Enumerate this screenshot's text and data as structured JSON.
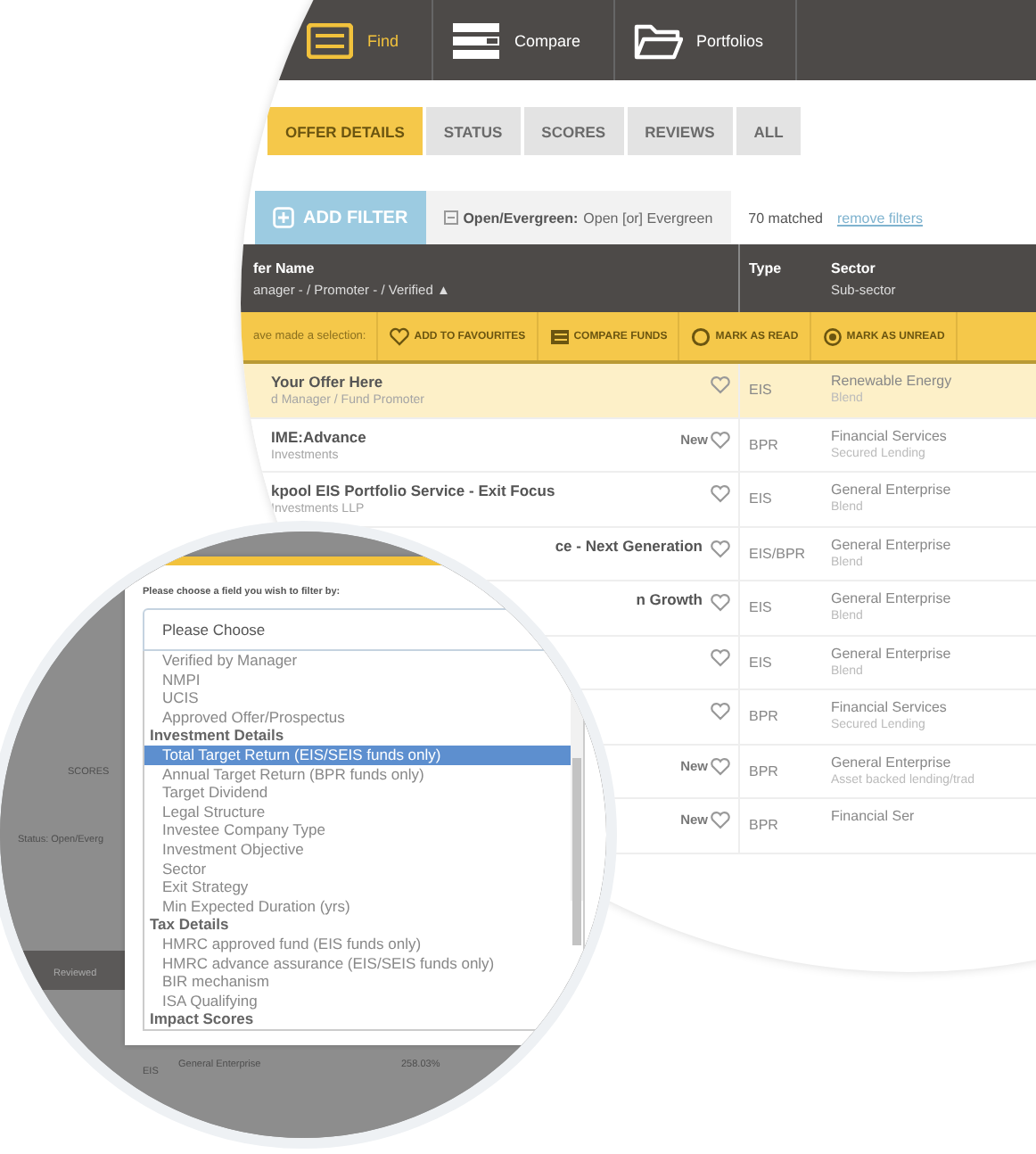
{
  "nav": {
    "items": [
      {
        "label": "Find",
        "selected": true
      },
      {
        "label": "Compare",
        "selected": false
      },
      {
        "label": "Portfolios",
        "selected": false
      }
    ]
  },
  "tabs": [
    {
      "label": "OFFER DETAILS",
      "selected": true
    },
    {
      "label": "STATUS",
      "selected": false
    },
    {
      "label": "SCORES",
      "selected": false
    },
    {
      "label": "REVIEWS",
      "selected": false
    },
    {
      "label": "ALL",
      "selected": false
    }
  ],
  "filter_bar": {
    "add_button": "ADD FILTER",
    "filter_name": "Open/Evergreen:",
    "filter_value": "Open [or] Evergreen",
    "matched": "70 matched",
    "remove_link": "remove filters"
  },
  "table": {
    "columns": [
      {
        "title": "fer Name",
        "subtitle": "anager - / Promoter - / Verified ▲"
      },
      {
        "title": "Type"
      },
      {
        "title": "Sector",
        "subtitle": "Sub-sector"
      }
    ],
    "selection_bar": {
      "label": "ave made a selection:",
      "actions": [
        {
          "label": "ADD TO FAVOURITES"
        },
        {
          "label": "COMPARE FUNDS"
        },
        {
          "label": "MARK AS READ"
        },
        {
          "label": "MARK AS UNREAD"
        }
      ]
    },
    "rows": [
      {
        "name": "Your Offer Here",
        "manager": "d Manager / Fund Promoter",
        "selected": true,
        "type": "EIS",
        "sector": "Renewable Energy",
        "sub_sector": "Blend"
      },
      {
        "name": "IME:Advance",
        "manager": "Investments",
        "new_label": "New",
        "selected": false,
        "type": "BPR",
        "sector": "Financial Services",
        "sub_sector": "Secured Lending"
      },
      {
        "name": "kpool EIS Portfolio Service - Exit Focus",
        "manager": "Investments LLP",
        "selected": false,
        "type": "EIS",
        "sector": "General Enterprise",
        "sub_sector": "Blend"
      },
      {
        "name": "ce - Next Generation",
        "selected": false,
        "cut": true,
        "type": "EIS/BPR",
        "sector": "General Enterprise",
        "sub_sector": "Blend"
      },
      {
        "name": "n Growth",
        "selected": false,
        "cut": true,
        "type": "EIS",
        "sector": "General Enterprise",
        "sub_sector": "Blend"
      },
      {
        "selected": false,
        "type": "EIS",
        "sector": "General Enterprise",
        "sub_sector": "Blend"
      },
      {
        "selected": false,
        "type": "BPR",
        "sector": "Financial Services",
        "sub_sector": "Secured Lending"
      },
      {
        "new_label": "New",
        "selected": false,
        "type": "BPR",
        "sector": "General Enterprise",
        "sub_sector": "Asset backed lending/trad"
      },
      {
        "new_label": "New",
        "selected": false,
        "type": "BPR",
        "sector": "Financial Ser"
      }
    ]
  },
  "background_page": {
    "tab": "SCORES",
    "filter": "Status: Open/Everg",
    "column": "Reviewed",
    "type": "EIS",
    "sector": "General Enterprise",
    "value": "258.03%"
  },
  "filter_dialog": {
    "prompt": "Please choose a field you wish to filter by:",
    "select": {
      "value": "Please Choose"
    },
    "groups": [
      {
        "options": [
          {
            "label": "Verified by Manager",
            "selected": false
          },
          {
            "label": "NMPI",
            "selected": false
          },
          {
            "label": "UCIS",
            "selected": false
          },
          {
            "label": "Approved Offer/Prospectus",
            "selected": false
          }
        ]
      },
      {
        "label": "Investment Details",
        "options": [
          {
            "label": "Total Target Return (EIS/SEIS funds only)",
            "selected": true
          },
          {
            "label": "Annual Target Return (BPR funds only)",
            "selected": false
          },
          {
            "label": "Target Dividend",
            "selected": false
          },
          {
            "label": "Legal Structure",
            "selected": false
          },
          {
            "label": "Investee Company Type",
            "selected": false
          },
          {
            "label": "Investment Objective",
            "selected": false
          },
          {
            "label": "Sector",
            "selected": false
          },
          {
            "label": "Exit Strategy",
            "selected": false
          },
          {
            "label": "Min Expected Duration (yrs)",
            "selected": false
          }
        ]
      },
      {
        "label": "Tax Details",
        "options": [
          {
            "label": "HMRC approved fund (EIS funds only)",
            "selected": false
          },
          {
            "label": "HMRC advance assurance (EIS/SEIS funds only)",
            "selected": false
          },
          {
            "label": "BIR mechanism",
            "selected": false
          },
          {
            "label": "ISA Qualifying",
            "selected": false
          }
        ]
      },
      {
        "label": "Impact Scores"
      }
    ]
  }
}
